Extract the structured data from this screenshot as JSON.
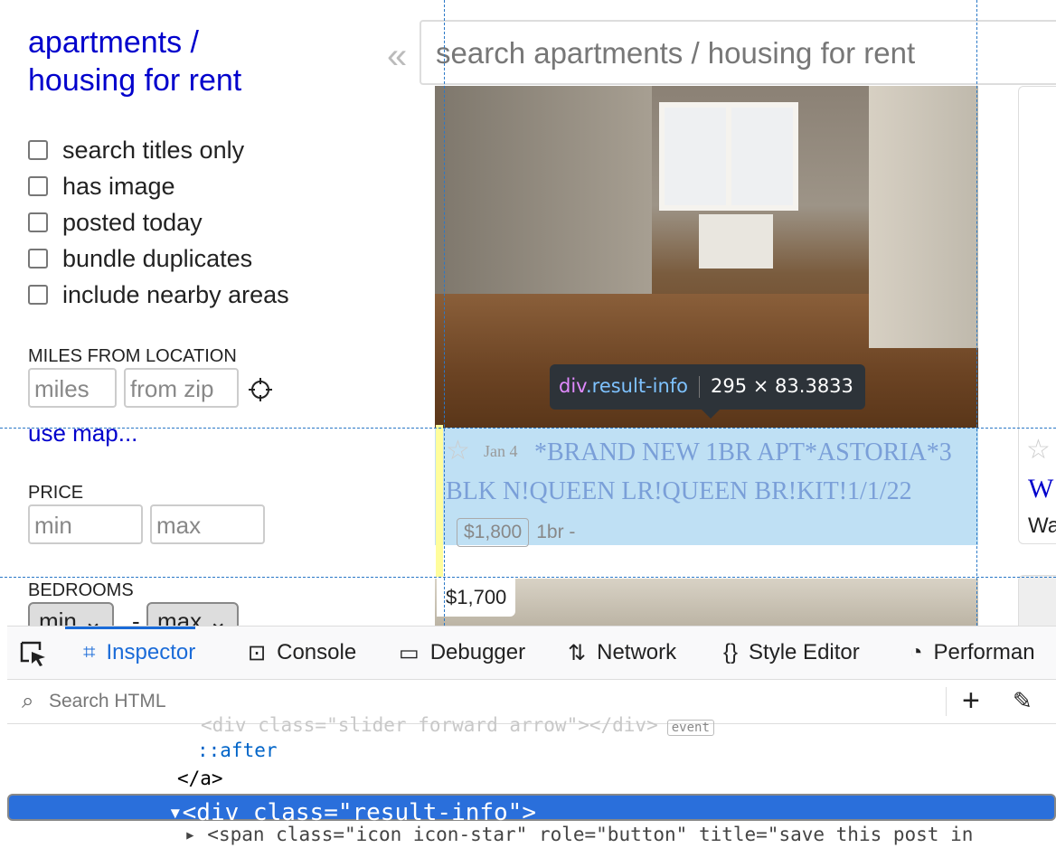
{
  "sidebar": {
    "title_line1": "apartments /",
    "title_line2": "housing for rent",
    "checkboxes": [
      {
        "label": "search titles only",
        "checked": false
      },
      {
        "label": "has image",
        "checked": false
      },
      {
        "label": "posted today",
        "checked": false
      },
      {
        "label": "bundle duplicates",
        "checked": false
      },
      {
        "label": "include nearby areas",
        "checked": false
      }
    ],
    "miles_section": "MILES FROM LOCATION",
    "miles_placeholder": "miles",
    "zip_placeholder": "from zip",
    "use_map": "use map...",
    "price_section": "PRICE",
    "price_min_placeholder": "min",
    "price_max_placeholder": "max",
    "bedrooms_section": "BEDROOMS",
    "bedrooms_min": "min",
    "bedrooms_dash": "-",
    "bedrooms_max": "max"
  },
  "collapse_glyph": "«",
  "search": {
    "placeholder": "search apartments / housing for rent"
  },
  "listing": {
    "date": "Jan 4",
    "title": "*BRAND NEW 1BR APT*ASTORIA*3 BLK N!QUEEN LR!QUEEN BR!KIT!1/1/22",
    "price": "$1,800",
    "meta": "1br -"
  },
  "next_listing": {
    "price": "$1,700"
  },
  "right_listing": {
    "title_fragment": "W",
    "subtitle_fragment": "Wa"
  },
  "tooltip": {
    "tag": "div",
    "class": ".result-info",
    "size": "295 × 83.3833"
  },
  "devtools": {
    "tabs": [
      {
        "icon": "inspector-icon",
        "label": "Inspector",
        "active": true
      },
      {
        "icon": "console-icon",
        "label": "Console",
        "active": false
      },
      {
        "icon": "debugger-icon",
        "label": "Debugger",
        "active": false
      },
      {
        "icon": "network-icon",
        "label": "Network",
        "active": false
      },
      {
        "icon": "style-editor-icon",
        "label": "Style Editor",
        "active": false
      },
      {
        "icon": "performance-icon",
        "label": "Performan",
        "active": false
      }
    ],
    "search_placeholder": "Search HTML",
    "code_lines": {
      "faded": "<div class=\"slider forward arrow\"></div>",
      "faded_badge": "event",
      "after": "::after",
      "close_a": "</a>",
      "selected": "<div class=\"result-info\">",
      "next": "<span class=\"icon icon-star\" role=\"button\" title=\"save this post in"
    }
  },
  "colors": {
    "link": "#0000cc",
    "highlight": "#bfe0f4",
    "devtools_accent": "#1a6bd8",
    "selection": "#2a6fdb"
  }
}
